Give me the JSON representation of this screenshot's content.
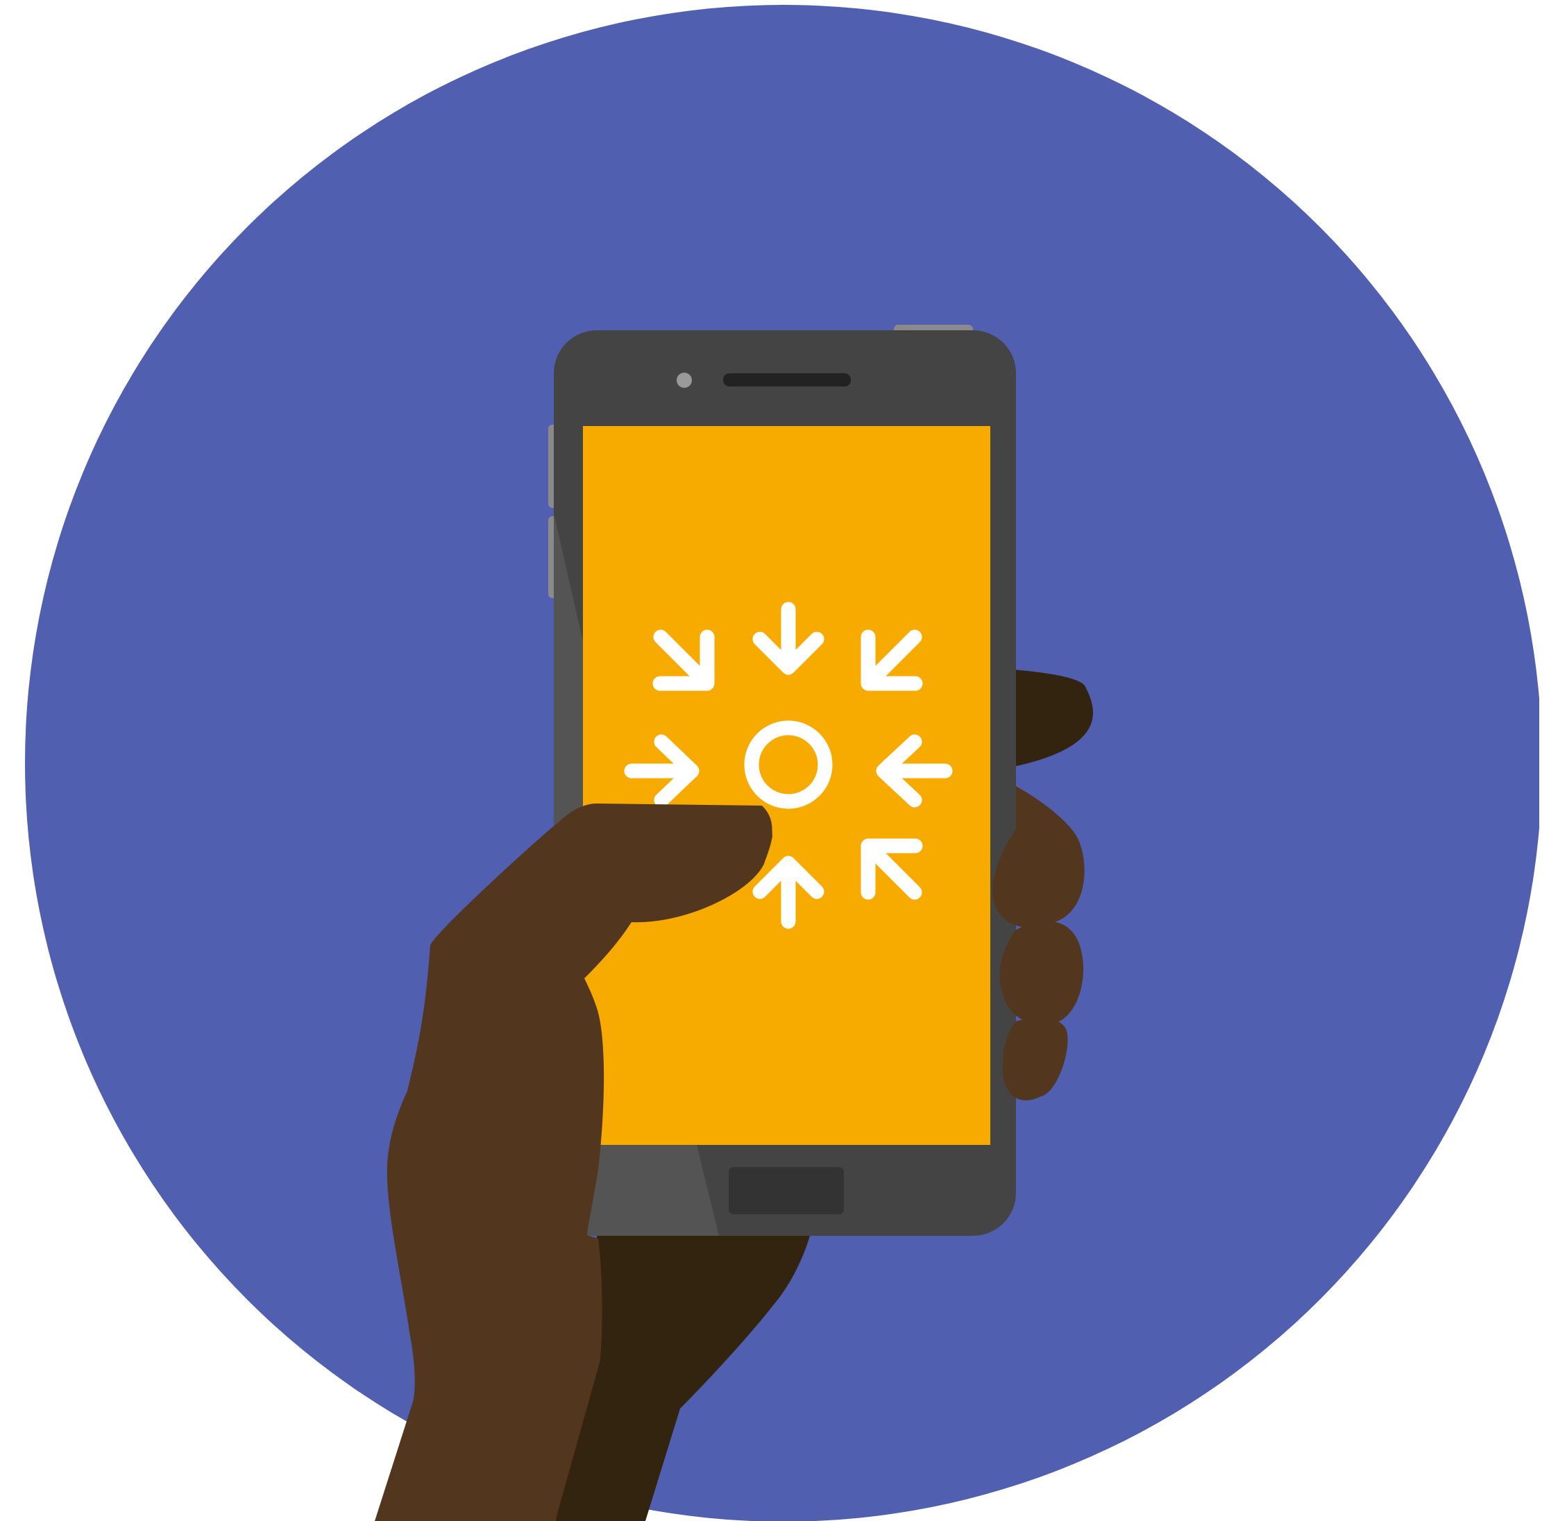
{
  "illustration": {
    "subject": "hand-holding-smartphone",
    "screen_icon": "arrows-converging-to-center-icon"
  },
  "colors": {
    "background": "#ffffff",
    "circle": "#505fb0",
    "phone_body": "#444444",
    "phone_body_shade": "#545454",
    "side_buttons": "#8a8a8a",
    "speaker": "#222222",
    "camera": "#9a9a9a",
    "home_button": "#333333",
    "screen": "#f7ab00",
    "icon": "#ffffff",
    "skin": "#52361d",
    "skin_shadow": "#332410"
  }
}
